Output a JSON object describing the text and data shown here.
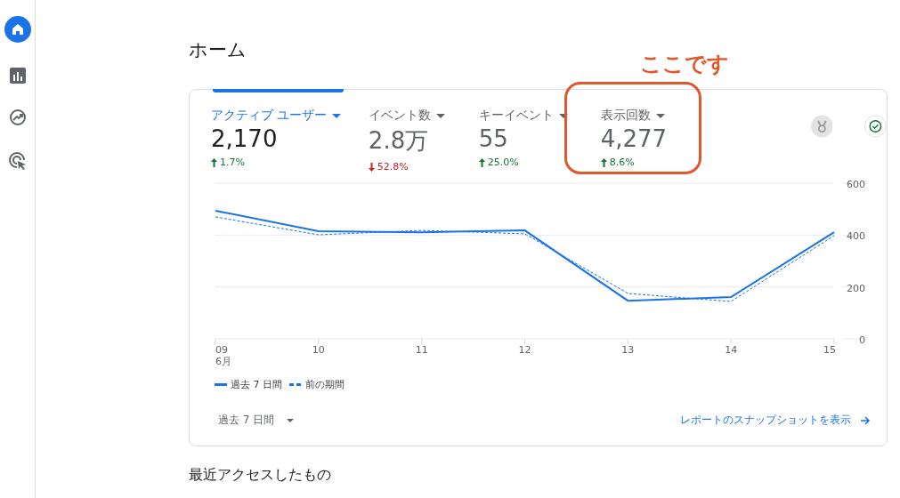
{
  "sidebar": {
    "items": [
      {
        "kind": "home",
        "selected": true
      },
      {
        "kind": "reports",
        "selected": false
      },
      {
        "kind": "explore",
        "selected": false
      },
      {
        "kind": "advertising",
        "selected": false
      }
    ]
  },
  "page_title": "ホーム",
  "annotation": {
    "text": "ここです"
  },
  "metrics": [
    {
      "label": "アクティブ ユーザー",
      "value": "2,170",
      "change": "1.7%",
      "kind": "up",
      "selected": true,
      "highlighted": false
    },
    {
      "label": "イベント数",
      "value": "2.8万",
      "change": "52.8%",
      "kind": "down",
      "selected": false,
      "highlighted": false
    },
    {
      "label": "キーイベント",
      "value": "55",
      "change": "25.0%",
      "kind": "up",
      "selected": false,
      "highlighted": false
    },
    {
      "label": "表示回数",
      "value": "4,277",
      "change": "8.6%",
      "kind": "up",
      "selected": false,
      "highlighted": true
    }
  ],
  "chart_data": {
    "type": "line",
    "categories": [
      "09",
      "10",
      "11",
      "12",
      "13",
      "14",
      "15"
    ],
    "xlabel": "6月",
    "ylim": [
      0,
      600
    ],
    "yticks": [
      0,
      200,
      400,
      600
    ],
    "series": [
      {
        "name": "過去 7 日間",
        "color": "#1a73e8",
        "line_style": "solid",
        "values": [
          494,
          415,
          411,
          418,
          147,
          161,
          411
        ]
      },
      {
        "name": "前の期間",
        "color": "#1a73e8",
        "line_style": "dashed",
        "values": [
          470,
          401,
          418,
          405,
          175,
          144,
          398
        ]
      }
    ]
  },
  "date_range": {
    "value": "過去 7 日間"
  },
  "report_link": "レポートのスナップショットを表示",
  "next_section_title": "最近アクセスしたもの"
}
